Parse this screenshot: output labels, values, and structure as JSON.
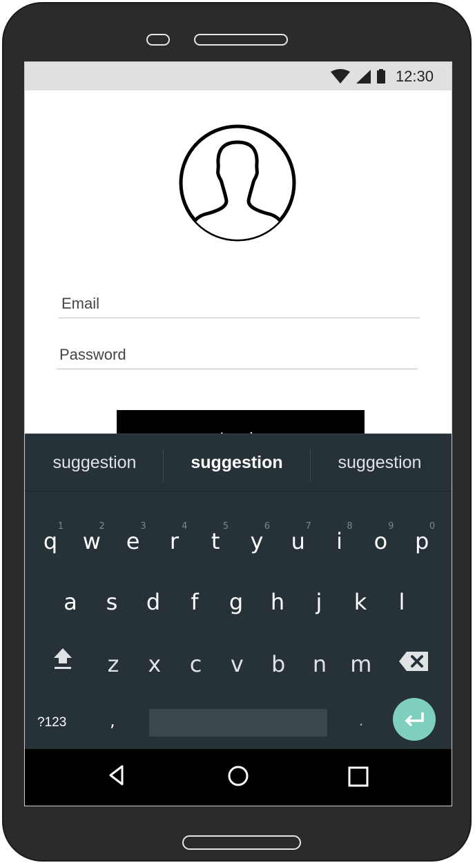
{
  "status": {
    "time": "12:30",
    "icons": [
      "wifi-icon",
      "signal-icon",
      "battery-icon"
    ]
  },
  "profile": {
    "icon": "user-avatar-icon"
  },
  "form": {
    "email_placeholder": "Email",
    "password_placeholder": "Password",
    "login_label": "Log in"
  },
  "keyboard": {
    "suggestions": [
      "suggestion",
      "suggestion",
      "suggestion"
    ],
    "row1": [
      {
        "k": "q",
        "h": "1"
      },
      {
        "k": "w",
        "h": "2"
      },
      {
        "k": "e",
        "h": "3"
      },
      {
        "k": "r",
        "h": "4"
      },
      {
        "k": "t",
        "h": "5"
      },
      {
        "k": "y",
        "h": "6"
      },
      {
        "k": "u",
        "h": "7"
      },
      {
        "k": "i",
        "h": "8"
      },
      {
        "k": "o",
        "h": "9"
      },
      {
        "k": "p",
        "h": "0"
      }
    ],
    "row2": [
      "a",
      "s",
      "d",
      "f",
      "g",
      "h",
      "j",
      "k",
      "l"
    ],
    "row3": [
      "z",
      "x",
      "c",
      "v",
      "b",
      "n",
      "m"
    ],
    "symbols_label": "?123",
    "comma": ",",
    "period": ".",
    "colors": {
      "background": "#263238",
      "enter": "#7ecfbd"
    }
  },
  "nav": {
    "icons": [
      "back-icon",
      "home-icon",
      "recents-icon"
    ]
  }
}
